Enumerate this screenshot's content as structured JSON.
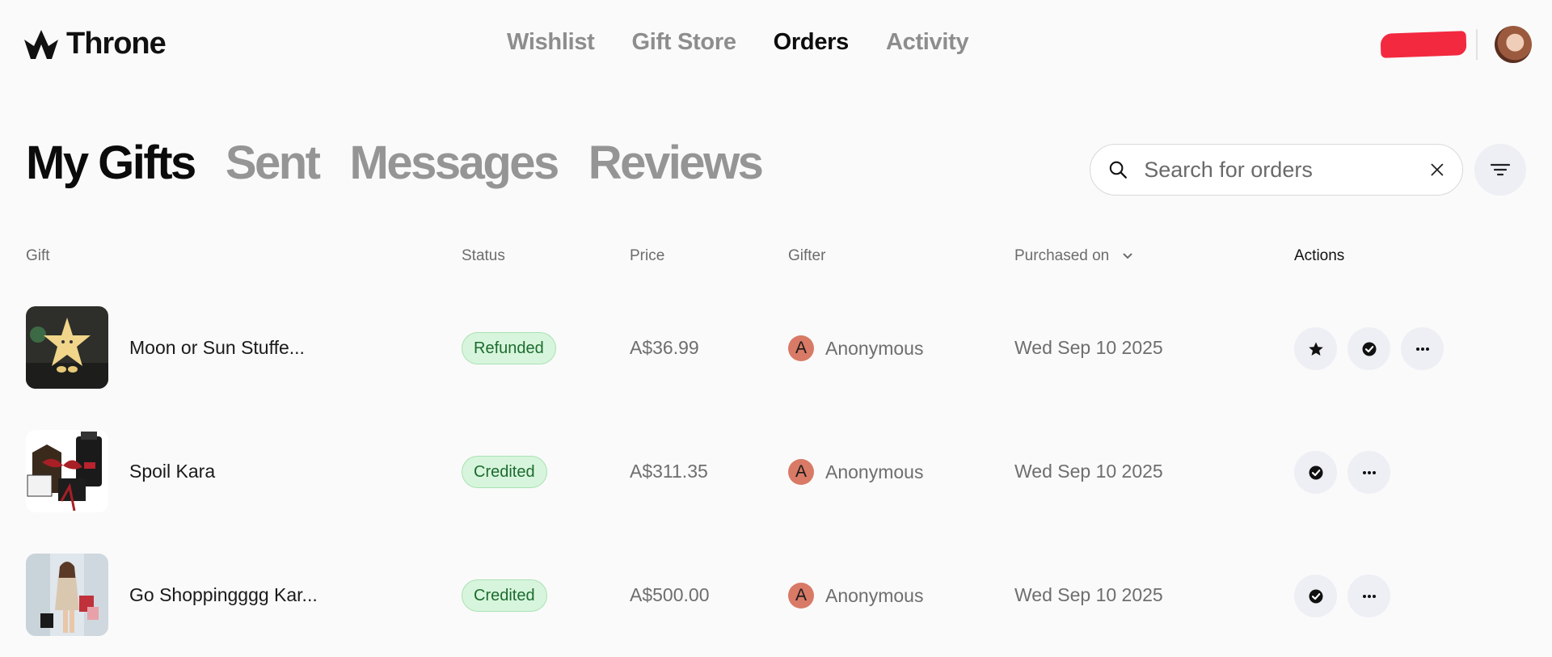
{
  "brand": {
    "name": "Throne"
  },
  "nav": {
    "items": [
      "Wishlist",
      "Gift Store",
      "Orders",
      "Activity"
    ],
    "active": "Orders"
  },
  "tabs": {
    "items": [
      "My Gifts",
      "Sent",
      "Messages",
      "Reviews"
    ],
    "active": "My Gifts"
  },
  "search": {
    "placeholder": "Search for orders",
    "value": ""
  },
  "table": {
    "headers": {
      "gift": "Gift",
      "status": "Status",
      "price": "Price",
      "gifter": "Gifter",
      "purchased_on": "Purchased on",
      "actions": "Actions"
    },
    "rows": [
      {
        "name": "Moon or Sun Stuffe...",
        "status": "Refunded",
        "price": "A$36.99",
        "gifter_initial": "A",
        "gifter": "Anonymous",
        "date": "Wed Sep 10 2025",
        "actions": [
          "star-icon",
          "check-badge-icon",
          "more-icon"
        ]
      },
      {
        "name": "Spoil Kara",
        "status": "Credited",
        "price": "A$311.35",
        "gifter_initial": "A",
        "gifter": "Anonymous",
        "date": "Wed Sep 10 2025",
        "actions": [
          "check-badge-icon",
          "more-icon"
        ]
      },
      {
        "name": "Go Shoppingggg Kar...",
        "status": "Credited",
        "price": "A$500.00",
        "gifter_initial": "A",
        "gifter": "Anonymous",
        "date": "Wed Sep 10 2025",
        "actions": [
          "check-badge-icon",
          "more-icon"
        ]
      }
    ]
  },
  "colors": {
    "badge_bg": "#d7f5dc",
    "badge_text": "#1c6b2e",
    "gifter_avatar": "#d87a66",
    "redaction": "#f2293f",
    "action_bg": "#edeff4"
  }
}
